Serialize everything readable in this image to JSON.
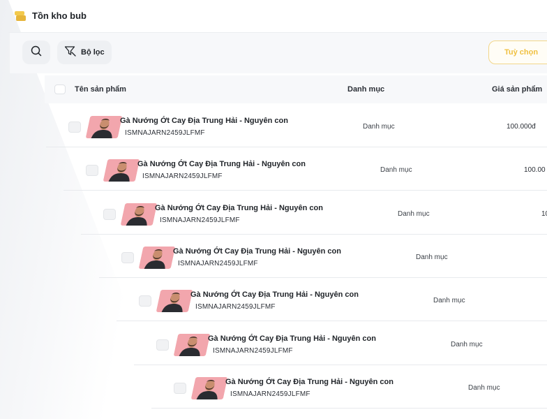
{
  "header": {
    "title": "Tồn kho bub"
  },
  "toolbar": {
    "filter_label": "Bộ lọc",
    "options_label": "Tuỳ chọn"
  },
  "table": {
    "columns": [
      "Tên sản phẩm",
      "Danh mục",
      "Giá sản phẩm"
    ],
    "rows": [
      {
        "name": "Gà Nướng Ớt Cay Địa Trung Hải - Nguyên con",
        "sku": "ISMNAJARN2459JLFMF",
        "category": "Danh mục",
        "price": "100.000đ"
      },
      {
        "name": "Gà Nướng Ớt Cay Địa Trung Hải - Nguyên con",
        "sku": "ISMNAJARN2459JLFMF",
        "category": "Danh mục",
        "price": "100.00"
      },
      {
        "name": "Gà Nướng Ớt Cay Địa Trung Hải - Nguyên con",
        "sku": "ISMNAJARN2459JLFMF",
        "category": "Danh mục",
        "price": "10"
      },
      {
        "name": "Gà Nướng Ớt Cay Địa Trung Hải - Nguyên con",
        "sku": "ISMNAJARN2459JLFMF",
        "category": "Danh mục",
        "price": ""
      },
      {
        "name": "Gà Nướng Ớt Cay Địa Trung Hải - Nguyên con",
        "sku": "ISMNAJARN2459JLFMF",
        "category": "Danh mục",
        "price": ""
      },
      {
        "name": "Gà Nướng Ớt Cay Địa Trung Hải - Nguyên con",
        "sku": "ISMNAJARN2459JLFMF",
        "category": "Danh mục",
        "price": ""
      },
      {
        "name": "Gà Nướng Ớt Cay Địa Trung Hải - Nguyên con",
        "sku": "ISMNAJARN2459JLFMF",
        "category": "Danh mục",
        "price": ""
      }
    ]
  },
  "colors": {
    "accent": "#f0c040",
    "header_bg": "#f7f8fa",
    "thumb_bg": "#f2a6ad"
  },
  "icons": {
    "app": "box-icon",
    "search": "search-icon",
    "filter": "filter-icon"
  }
}
